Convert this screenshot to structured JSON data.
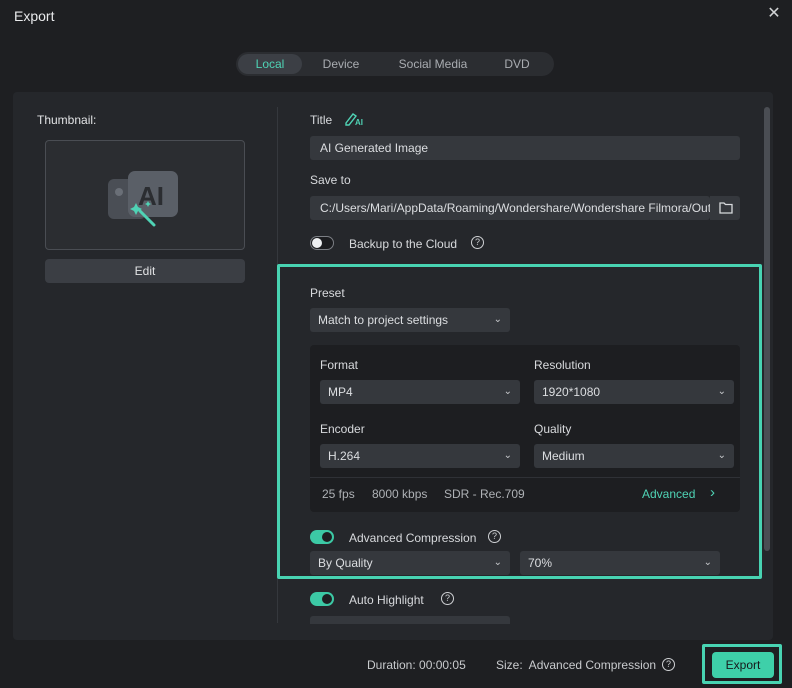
{
  "window": {
    "title": "Export",
    "close_glyph": "✕"
  },
  "tabs": [
    {
      "label": "Local",
      "active": true
    },
    {
      "label": "Device"
    },
    {
      "label": "Social Media"
    },
    {
      "label": "DVD"
    }
  ],
  "thumbnail": {
    "label": "Thumbnail:",
    "edit_label": "Edit",
    "icon": "ai-image-icon"
  },
  "title_field": {
    "label": "Title",
    "value": "AI Generated Image",
    "icon": "ai-pen-icon"
  },
  "save_to": {
    "label": "Save to",
    "value": "C:/Users/Mari/AppData/Roaming/Wondershare/Wondershare Filmora/Output",
    "icon": "folder-icon"
  },
  "backup": {
    "label": "Backup to the Cloud",
    "enabled": false
  },
  "preset": {
    "label": "Preset",
    "value": "Match to project settings"
  },
  "format": {
    "label": "Format",
    "value": "MP4"
  },
  "resolution": {
    "label": "Resolution",
    "value": "1920*1080"
  },
  "encoder": {
    "label": "Encoder",
    "value": "H.264"
  },
  "quality": {
    "label": "Quality",
    "value": "Medium"
  },
  "info": {
    "fps": "25 fps",
    "bitrate": "8000 kbps",
    "color": "SDR - Rec.709",
    "advanced_label": "Advanced",
    "advanced_chevron": "›"
  },
  "advanced_compression": {
    "label": "Advanced Compression",
    "enabled": true,
    "mode": "By Quality",
    "percent": "70%"
  },
  "auto_highlight": {
    "label": "Auto Highlight",
    "enabled": true
  },
  "footer": {
    "duration": "Duration: 00:00:05",
    "size": "Size:  Advanced Compression",
    "export_label": "Export"
  },
  "colors": {
    "accent": "#4fd3b5",
    "highlight_border": "#48d3b2",
    "background": "#1e1f22"
  }
}
